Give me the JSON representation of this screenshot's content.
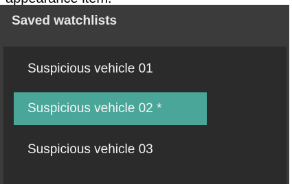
{
  "background_text": "appearance item.",
  "panel": {
    "title": "Saved watchlists",
    "items": [
      {
        "label": "Suspicious vehicle 01",
        "selected": false
      },
      {
        "label": "Suspicious vehicle 02 *",
        "selected": true
      },
      {
        "label": "Suspicious vehicle 03",
        "selected": false
      }
    ]
  },
  "colors": {
    "panel_background": "#3b3b3b",
    "list_background": "#2b2b2b",
    "selection_accent": "#4aa699",
    "text": "#f2f2f2"
  }
}
